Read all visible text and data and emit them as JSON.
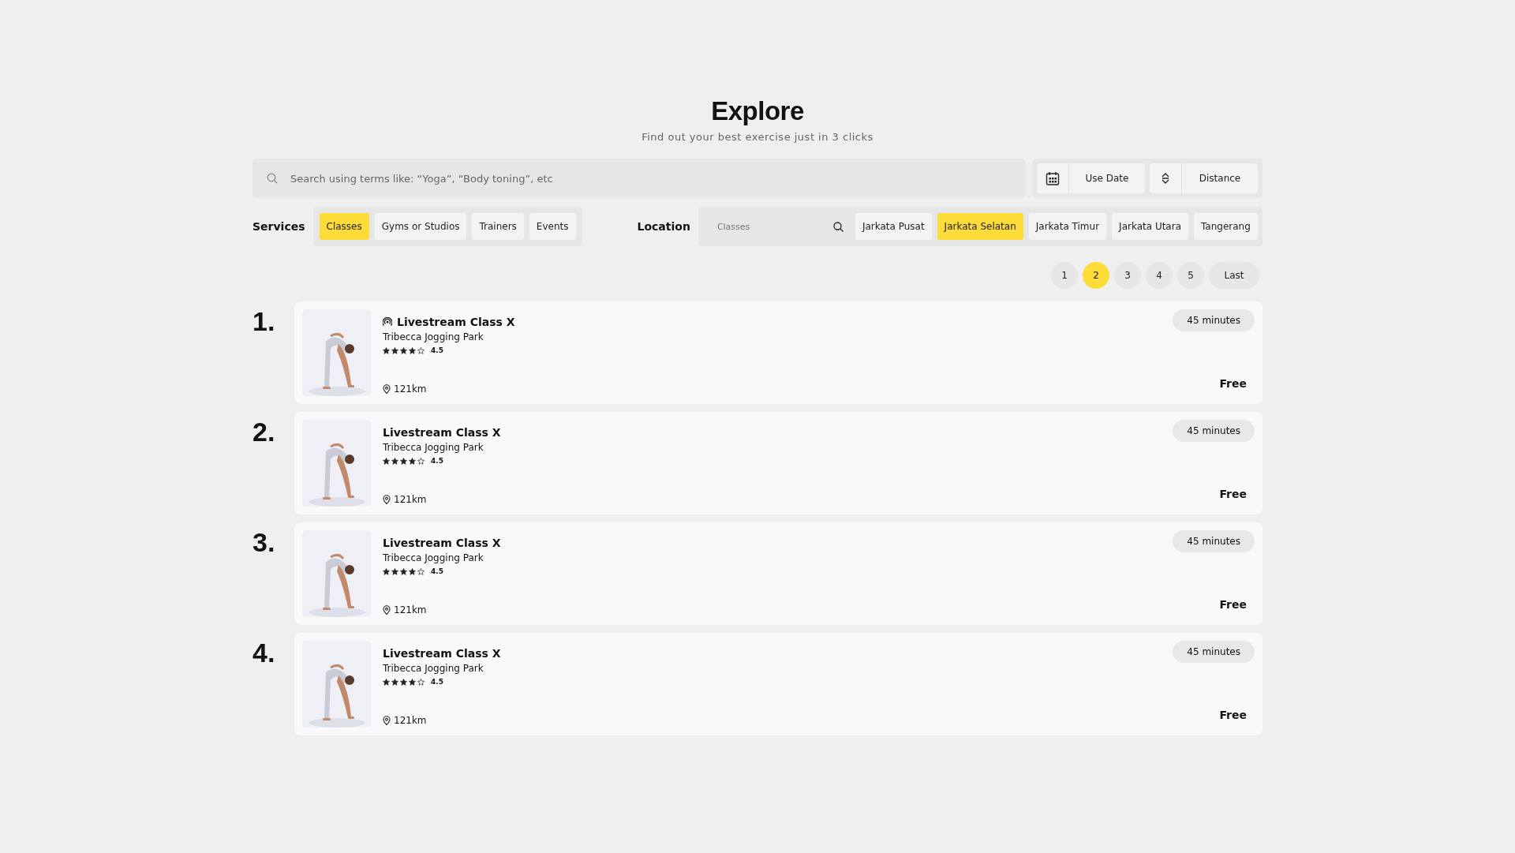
{
  "header": {
    "title": "Explore",
    "subtitle": "Find out your best exercise just in 3 clicks"
  },
  "search": {
    "placeholder": "Search using terms like: “Yoga”, “Body toning”, etc"
  },
  "filters": [
    {
      "kind": "date",
      "label": "Use Date"
    },
    {
      "kind": "sort",
      "label": "Distance"
    }
  ],
  "services": {
    "label": "Services",
    "options": [
      {
        "label": "Classes",
        "selected": true
      },
      {
        "label": "Gyms or Studios",
        "selected": false
      },
      {
        "label": "Trainers",
        "selected": false
      },
      {
        "label": "Events",
        "selected": false
      }
    ]
  },
  "location": {
    "label": "Location",
    "placeholder": "Classes",
    "options": [
      {
        "label": "Jarkata Pusat",
        "selected": false
      },
      {
        "label": "Jarkata Selatan",
        "selected": true
      },
      {
        "label": "Jarkata Timur",
        "selected": false
      },
      {
        "label": "Jarkata Utara",
        "selected": false
      },
      {
        "label": "Tangerang",
        "selected": false
      }
    ]
  },
  "pagination": [
    {
      "label": "1",
      "selected": false
    },
    {
      "label": "2",
      "selected": true
    },
    {
      "label": "3",
      "selected": false
    },
    {
      "label": "4",
      "selected": false
    },
    {
      "label": "5",
      "selected": false
    },
    {
      "label": "Last",
      "selected": false
    }
  ],
  "results": [
    {
      "rank": "1.",
      "title": "Livestream Class X",
      "live": true,
      "venue": "Tribecca Jogging Park",
      "stars": 4,
      "rating": "4.5",
      "distance": "121km",
      "duration": "45 minutes",
      "price": "Free"
    },
    {
      "rank": "2.",
      "title": "Livestream Class X",
      "live": false,
      "venue": "Tribecca Jogging Park",
      "stars": 4,
      "rating": "4.5",
      "distance": "121km",
      "duration": "45 minutes",
      "price": "Free"
    },
    {
      "rank": "3.",
      "title": "Livestream Class X",
      "live": false,
      "venue": "Tribecca Jogging Park",
      "stars": 4,
      "rating": "4.5",
      "distance": "121km",
      "duration": "45 minutes",
      "price": "Free"
    },
    {
      "rank": "4.",
      "title": "Livestream Class X",
      "live": false,
      "venue": "Tribecca Jogging Park",
      "stars": 4,
      "rating": "4.5",
      "distance": "121km",
      "duration": "45 minutes",
      "price": "Free"
    }
  ]
}
